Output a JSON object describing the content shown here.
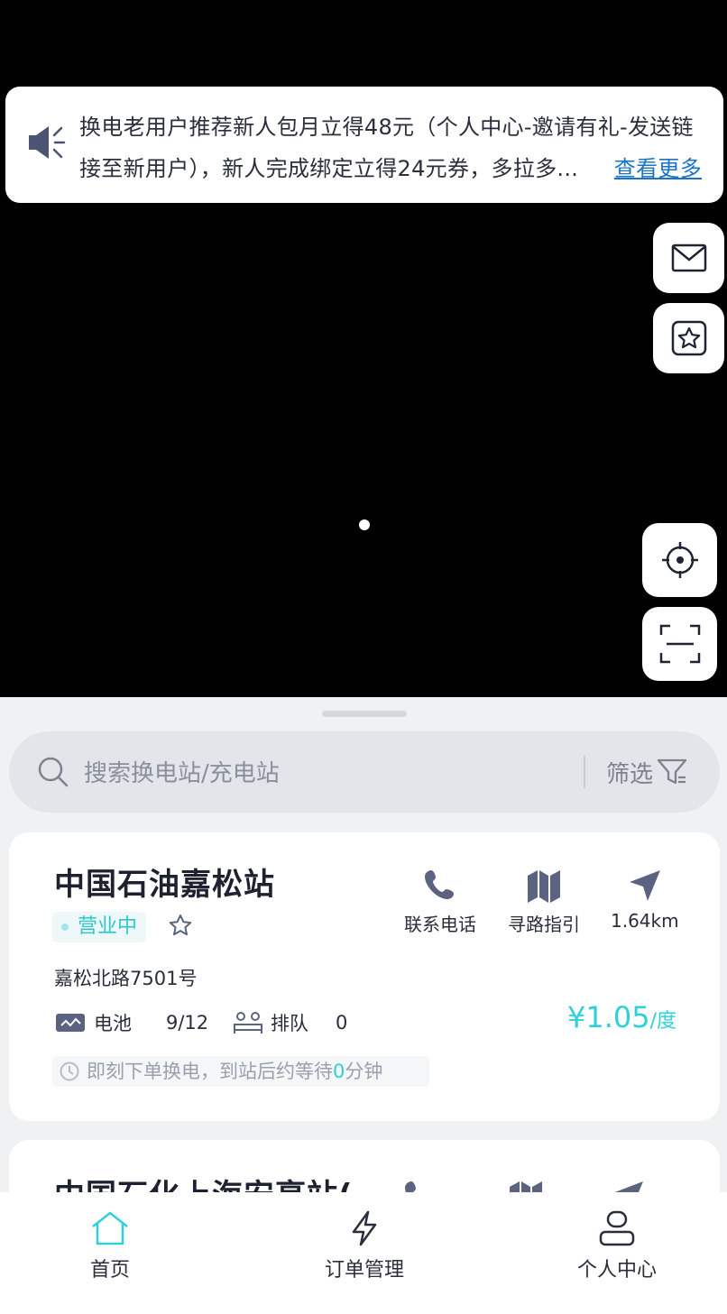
{
  "notice": {
    "text": "换电老用户推荐新人包月立得48元（个人中心-邀请有礼-发送链接至新用户），新人完成绑定立得24元券，多拉多...",
    "more_label": "查看更多"
  },
  "search": {
    "placeholder": "搜索换电站/充电站",
    "filter_label": "筛选"
  },
  "stations": [
    {
      "name": "中国石油嘉松站",
      "status": "营业中",
      "address": "嘉松北路7501号",
      "actions": {
        "phone": "联系电话",
        "route": "寻路指引",
        "distance": "1.64km"
      },
      "battery_label": "电池",
      "battery_value": "9/12",
      "queue_label": "排队",
      "queue_value": "0",
      "price": "¥1.05",
      "price_unit": "/度",
      "eta_prefix": "即刻下单换电，到站后约等待",
      "eta_value": "0",
      "eta_suffix": "分钟"
    },
    {
      "name": "中国石化上海安亭站(",
      "status": "",
      "address": ""
    }
  ],
  "tabs": [
    {
      "label": "首页",
      "active": true
    },
    {
      "label": "订单管理",
      "active": false
    },
    {
      "label": "个人中心",
      "active": false
    }
  ],
  "colors": {
    "accent": "#2fd0d8",
    "link": "#1a73c6",
    "icon": "#5b6380"
  },
  "icons": [
    "speaker-icon",
    "mail-icon",
    "star-icon",
    "locate-icon",
    "scan-icon",
    "search-icon",
    "filter-icon",
    "phone-icon",
    "map-icon",
    "navigate-icon",
    "battery-icon",
    "queue-icon",
    "clock-icon",
    "home-icon",
    "bolt-icon",
    "user-icon"
  ]
}
